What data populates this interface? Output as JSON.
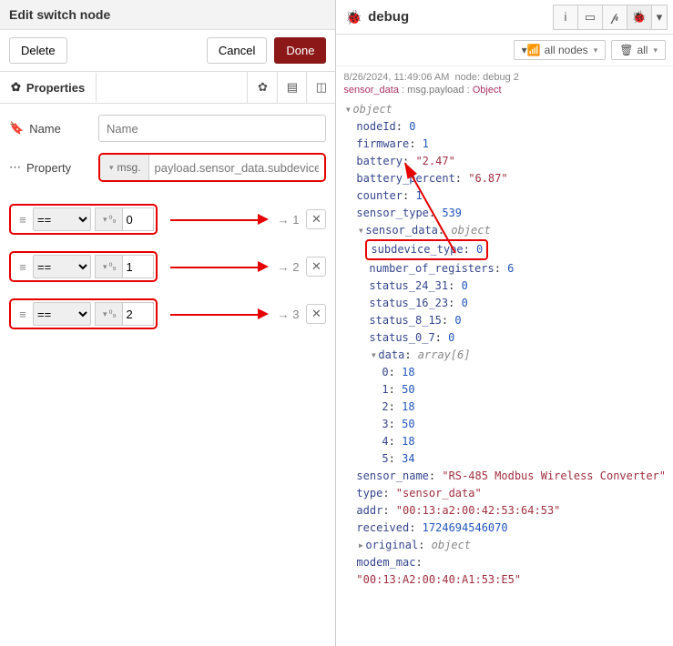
{
  "left": {
    "title": "Edit switch node",
    "buttons": {
      "delete": "Delete",
      "cancel": "Cancel",
      "done": "Done"
    },
    "tab_properties": "Properties",
    "name_label": "Name",
    "name_placeholder": "Name",
    "property_label": "Property",
    "prefix": "msg.",
    "property_value": "payload.sensor_data.subdevice_type",
    "rules": [
      {
        "op": "==",
        "value": "0",
        "out": "→ 1"
      },
      {
        "op": "==",
        "value": "1",
        "out": "→ 2"
      },
      {
        "op": "==",
        "value": "2",
        "out": "→ 3"
      }
    ],
    "num_pill": "⁰₉"
  },
  "right": {
    "title": "debug",
    "filter_all_nodes": "all nodes",
    "filter_all": "all",
    "meta_time": "8/26/2024, 11:49:06 AM",
    "meta_node": "node: debug 2",
    "path_src": "sensor_data",
    "path_rest": "msg.payload",
    "path_type": "Object",
    "obj_label": "object",
    "fields": {
      "nodeId": {
        "k": "nodeId",
        "v": "0",
        "t": "num"
      },
      "firmware": {
        "k": "firmware",
        "v": "1",
        "t": "num"
      },
      "battery": {
        "k": "battery",
        "v": "\"2.47\"",
        "t": "str"
      },
      "battery_percent": {
        "k": "battery_percent",
        "v": "\"6.87\"",
        "t": "str"
      },
      "counter": {
        "k": "counter",
        "v": "1",
        "t": "num"
      },
      "sensor_type": {
        "k": "sensor_type",
        "v": "539",
        "t": "num"
      },
      "sensor_data": {
        "k": "sensor_data",
        "v": "object",
        "t": "typ"
      },
      "subdevice_type": {
        "k": "subdevice_type",
        "v": "0",
        "t": "num"
      },
      "number_of_registers": {
        "k": "number_of_registers",
        "v": "6",
        "t": "num"
      },
      "status_24_31": {
        "k": "status_24_31",
        "v": "0",
        "t": "num"
      },
      "status_16_23": {
        "k": "status_16_23",
        "v": "0",
        "t": "num"
      },
      "status_8_15": {
        "k": "status_8_15",
        "v": "0",
        "t": "num"
      },
      "status_0_7": {
        "k": "status_0_7",
        "v": "0",
        "t": "num"
      },
      "data_label": {
        "k": "data",
        "v": "array[6]",
        "t": "typ"
      },
      "d0": {
        "k": "0",
        "v": "18"
      },
      "d1": {
        "k": "1",
        "v": "50"
      },
      "d2": {
        "k": "2",
        "v": "18"
      },
      "d3": {
        "k": "3",
        "v": "50"
      },
      "d4": {
        "k": "4",
        "v": "18"
      },
      "d5": {
        "k": "5",
        "v": "34"
      },
      "sensor_name": {
        "k": "sensor_name",
        "v": "\"RS-485 Modbus Wireless Converter\"",
        "t": "str"
      },
      "type": {
        "k": "type",
        "v": "\"sensor_data\"",
        "t": "str"
      },
      "addr": {
        "k": "addr",
        "v": "\"00:13:a2:00:42:53:64:53\"",
        "t": "str"
      },
      "received": {
        "k": "received",
        "v": "1724694546070",
        "t": "num"
      },
      "original": {
        "k": "original",
        "v": "object",
        "t": "typ"
      },
      "modem_mac": {
        "k": "modem_mac",
        "v": "\"00:13:A2:00:40:A1:53:E5\"",
        "t": "str"
      }
    }
  }
}
